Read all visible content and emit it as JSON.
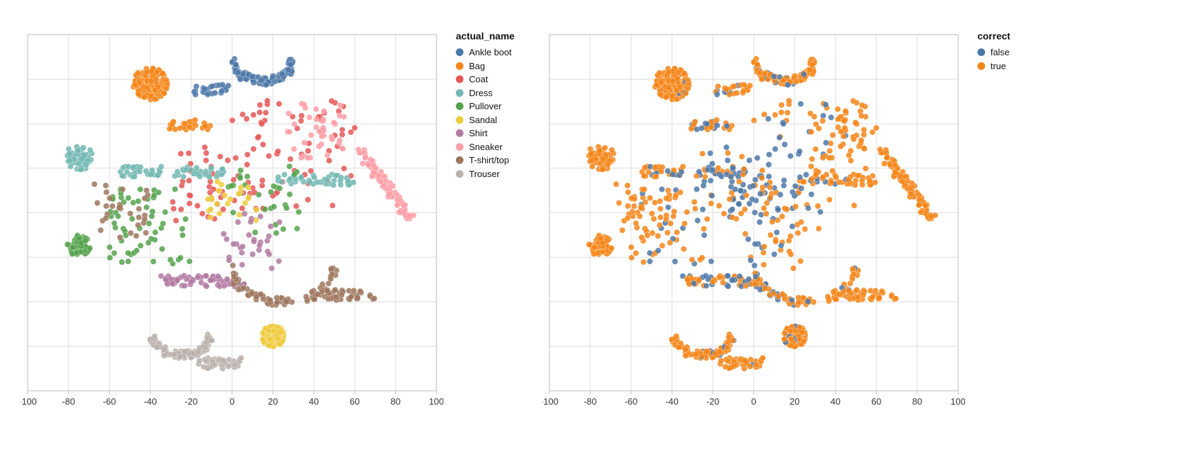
{
  "chart_data": [
    {
      "type": "scatter",
      "xlabel": "",
      "ylabel": "",
      "xlim": [
        -100,
        100
      ],
      "ylim": [
        -65,
        65
      ],
      "xticks": [
        -100,
        -80,
        -60,
        -40,
        -20,
        0,
        20,
        40,
        60,
        80,
        100
      ],
      "legend_title": "actual_name",
      "legend": [
        {
          "name": "Ankle boot",
          "color": "#4c78a8"
        },
        {
          "name": "Bag",
          "color": "#f58518"
        },
        {
          "name": "Coat",
          "color": "#e45756"
        },
        {
          "name": "Dress",
          "color": "#72b7b2"
        },
        {
          "name": "Pullover",
          "color": "#54a24b"
        },
        {
          "name": "Sandal",
          "color": "#eeca3b"
        },
        {
          "name": "Shirt",
          "color": "#b279a2"
        },
        {
          "name": "Sneaker",
          "color": "#ff9da6"
        },
        {
          "name": "T-shirt/top",
          "color": "#9d755d"
        },
        {
          "name": "Trouser",
          "color": "#bab0ac"
        }
      ],
      "clusters": [
        {
          "cat": "Ankle boot",
          "cx": 15,
          "cy": 55,
          "spread": 14,
          "n": 110,
          "shape": "arc"
        },
        {
          "cat": "Ankle boot",
          "cx": -10,
          "cy": 45,
          "spread": 8,
          "n": 25,
          "shape": "line"
        },
        {
          "cat": "Bag",
          "cx": -40,
          "cy": 47,
          "spread": 12,
          "n": 140,
          "shape": "blob"
        },
        {
          "cat": "Bag",
          "cx": -22,
          "cy": 32,
          "spread": 10,
          "n": 30,
          "shape": "line"
        },
        {
          "cat": "Coat",
          "cx": 30,
          "cy": 20,
          "spread": 30,
          "n": 70,
          "shape": "scatter"
        },
        {
          "cat": "Coat",
          "cx": -10,
          "cy": 10,
          "spread": 20,
          "n": 40,
          "shape": "scatter"
        },
        {
          "cat": "Dress",
          "cx": -75,
          "cy": 20,
          "spread": 10,
          "n": 60,
          "shape": "blob"
        },
        {
          "cat": "Dress",
          "cx": -30,
          "cy": 15,
          "spread": 25,
          "n": 60,
          "shape": "line"
        },
        {
          "cat": "Dress",
          "cx": 40,
          "cy": 12,
          "spread": 20,
          "n": 40,
          "shape": "line"
        },
        {
          "cat": "Pullover",
          "cx": -75,
          "cy": -12,
          "spread": 8,
          "n": 60,
          "shape": "blob"
        },
        {
          "cat": "Pullover",
          "cx": -40,
          "cy": -5,
          "spread": 20,
          "n": 60,
          "shape": "scatter"
        },
        {
          "cat": "Pullover",
          "cx": 15,
          "cy": 5,
          "spread": 18,
          "n": 30,
          "shape": "scatter"
        },
        {
          "cat": "Sandal",
          "cx": 20,
          "cy": -45,
          "spread": 8,
          "n": 85,
          "shape": "blob"
        },
        {
          "cat": "Sandal",
          "cx": 0,
          "cy": 5,
          "spread": 12,
          "n": 25,
          "shape": "scatter"
        },
        {
          "cat": "Shirt",
          "cx": -15,
          "cy": -25,
          "spread": 20,
          "n": 60,
          "shape": "line"
        },
        {
          "cat": "Shirt",
          "cx": 10,
          "cy": -10,
          "spread": 15,
          "n": 30,
          "shape": "scatter"
        },
        {
          "cat": "Sneaker",
          "cx": 75,
          "cy": 10,
          "spread": 18,
          "n": 90,
          "shape": "line",
          "angle": -45
        },
        {
          "cat": "Sneaker",
          "cx": 40,
          "cy": 30,
          "spread": 15,
          "n": 40,
          "shape": "scatter"
        },
        {
          "cat": "T-shirt/top",
          "cx": 25,
          "cy": -20,
          "spread": 25,
          "n": 70,
          "shape": "arc"
        },
        {
          "cat": "T-shirt/top",
          "cx": 55,
          "cy": -30,
          "spread": 15,
          "n": 40,
          "shape": "line"
        },
        {
          "cat": "T-shirt/top",
          "cx": -55,
          "cy": 0,
          "spread": 15,
          "n": 30,
          "shape": "scatter"
        },
        {
          "cat": "Trouser",
          "cx": -25,
          "cy": -45,
          "spread": 14,
          "n": 100,
          "shape": "arc"
        },
        {
          "cat": "Trouser",
          "cx": -5,
          "cy": -55,
          "spread": 10,
          "n": 40,
          "shape": "line"
        }
      ]
    },
    {
      "type": "scatter",
      "xlabel": "",
      "ylabel": "",
      "xlim": [
        -100,
        100
      ],
      "ylim": [
        -65,
        65
      ],
      "xticks": [
        -100,
        -80,
        -60,
        -40,
        -20,
        0,
        20,
        40,
        60,
        80,
        100
      ],
      "legend_title": "correct",
      "legend": [
        {
          "name": "false",
          "color": "#4c78a8"
        },
        {
          "name": "true",
          "color": "#f58518"
        }
      ],
      "false_ratio_hint": 0.18
    }
  ]
}
